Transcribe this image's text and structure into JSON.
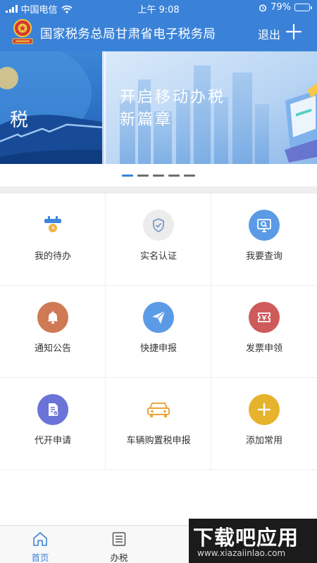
{
  "status_bar": {
    "carrier": "中国电信",
    "time": "上午 9:08",
    "battery": "79%",
    "battery_fraction": 0.79
  },
  "app_bar": {
    "title": "国家税务总局甘肃省电子税务局",
    "logout": "退出",
    "plus_icon": "plus-icon",
    "emblem_icon": "tax-emblem-icon"
  },
  "banner": {
    "headline_1": "开启移动办税",
    "headline_2": "新篇章",
    "left_fragment": "税",
    "slide_count": 5,
    "active_slide": 1
  },
  "grid": {
    "items": [
      {
        "label": "我的待办",
        "icon": "calendar-clock-icon",
        "color": "#5b9be6",
        "shape": "square"
      },
      {
        "label": "实名认证",
        "icon": "shield-check-icon",
        "color": "#ececec"
      },
      {
        "label": "我要查询",
        "icon": "monitor-search-icon",
        "color": "#5b9be6"
      },
      {
        "label": "通知公告",
        "icon": "bell-icon",
        "color": "#cf7a54"
      },
      {
        "label": "快捷申报",
        "icon": "paper-plane-icon",
        "color": "#5b9be6"
      },
      {
        "label": "发票申领",
        "icon": "ticket-yuan-icon",
        "color": "#cf5a5a"
      },
      {
        "label": "代开申请",
        "icon": "document-edit-icon",
        "color": "#6a73d8"
      },
      {
        "label": "车辆购置税申报",
        "icon": "car-icon",
        "color": "#e8b04a"
      },
      {
        "label": "添加常用",
        "icon": "add-icon",
        "color": "#e6b32c"
      }
    ]
  },
  "tab_bar": {
    "tabs": [
      {
        "label": "首页",
        "icon": "home-icon",
        "active": true
      },
      {
        "label": "办税",
        "icon": "list-icon",
        "active": false
      }
    ]
  },
  "watermark": {
    "big": "下载吧应用",
    "small": "www.xiazaiinlao.com"
  }
}
